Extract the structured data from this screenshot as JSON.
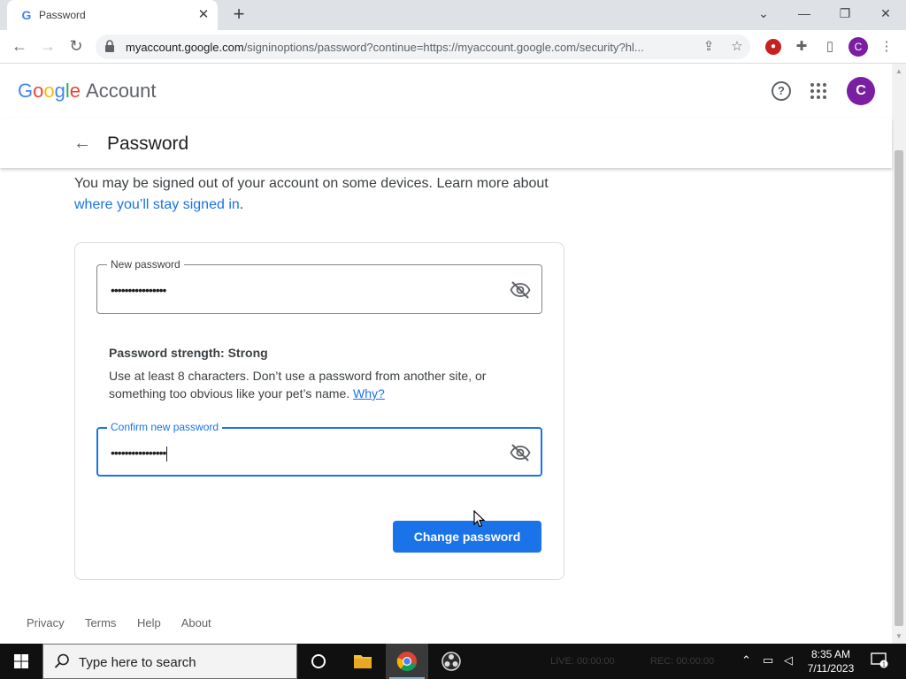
{
  "browser": {
    "tab_title": "Password",
    "tab_favicon": "G",
    "url_host": "myaccount.google.com",
    "url_rest": "/signinoptions/password?continue=https://myaccount.google.com/security?hl...",
    "profile_initial": "C"
  },
  "header": {
    "logo_letters": [
      "G",
      "o",
      "o",
      "g",
      "l",
      "e"
    ],
    "product": "Account",
    "avatar_initial": "C"
  },
  "subheader": {
    "title": "Password"
  },
  "intro": {
    "text": "You may be signed out of your account on some devices. Learn more about",
    "link": "where you’ll stay signed in",
    "period": "."
  },
  "form": {
    "new_password_label": "New password",
    "new_password_value": "••••••••••••••••",
    "strength_title": "Password strength: Strong",
    "strength_desc": "Use at least 8 characters. Don’t use a password from another site, or something too obvious like your pet’s name.",
    "strength_link": "Why?",
    "confirm_label": "Confirm new password",
    "confirm_value": "••••••••••••••••",
    "submit_label": "Change password"
  },
  "footer": {
    "links": [
      "Privacy",
      "Terms",
      "Help",
      "About"
    ]
  },
  "taskbar": {
    "search_placeholder": "Type here to search",
    "obs_live": "LIVE: 00:00:00",
    "obs_rec": "REC: 00:00:00",
    "time": "8:35 AM",
    "date": "7/11/2023",
    "notification_count": "1"
  },
  "colors": {
    "accent": "#1a73e8",
    "avatar": "#7b1fa2"
  }
}
